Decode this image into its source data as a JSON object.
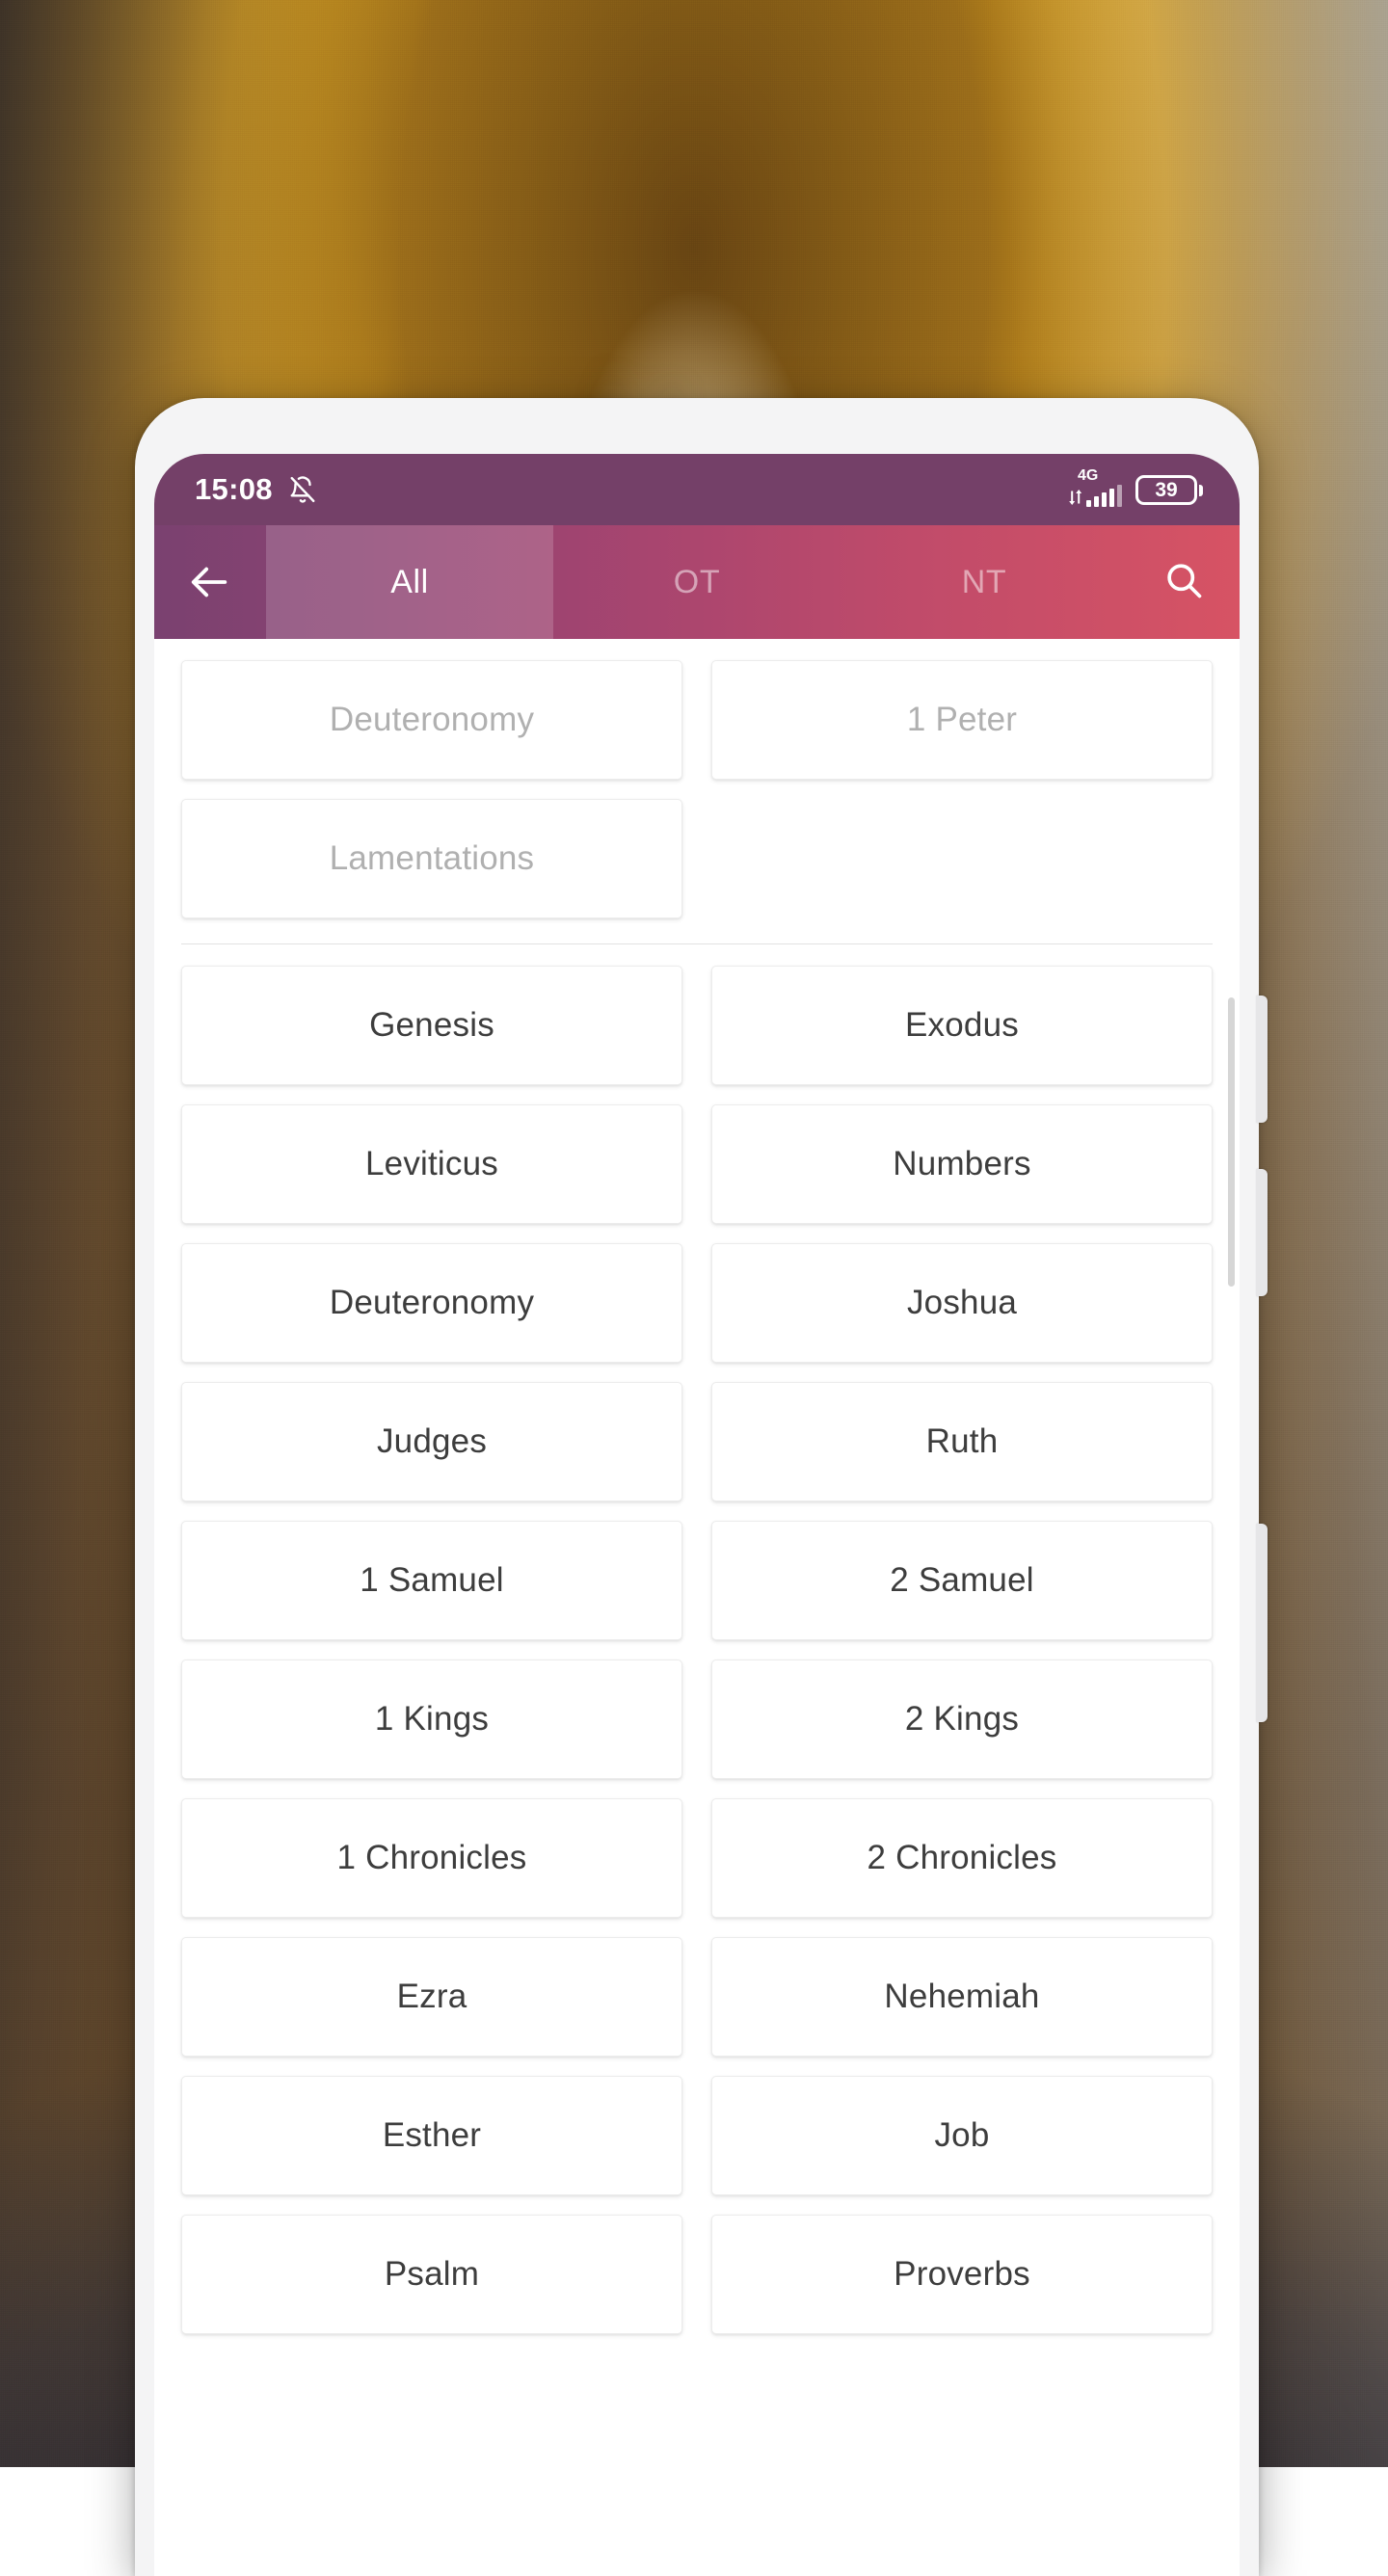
{
  "background": {
    "description": "blurred golden arched tunnel photo",
    "gold": "#f5bd1c",
    "brown": "#8a6434",
    "navy": "#1d2640"
  },
  "phone": {
    "bezel_color": "#f4f4f5",
    "buttons": [
      {
        "name": "volume-up"
      },
      {
        "name": "volume-down"
      },
      {
        "name": "power"
      }
    ]
  },
  "statusbar": {
    "background": "#744068",
    "clock": "15:08",
    "silent_icon": "bell-slash-icon",
    "network_label": "4G",
    "data_icon": "data-transfer-icon",
    "signal_icon": "signal-bars-icon",
    "battery_level": "39",
    "battery_icon": "battery-icon"
  },
  "appbar": {
    "gradient_start": "#7a4170",
    "gradient_end": "#d75364",
    "back_icon": "arrow-left-icon",
    "search_icon": "search-icon",
    "tabs": [
      {
        "label": "All",
        "active": true
      },
      {
        "label": "OT",
        "active": false
      },
      {
        "label": "NT",
        "active": false
      }
    ]
  },
  "content": {
    "recent_books": [
      "Deuteronomy",
      "1 Peter",
      "Lamentations"
    ],
    "books": [
      "Genesis",
      "Exodus",
      "Leviticus",
      "Numbers",
      "Deuteronomy",
      "Joshua",
      "Judges",
      "Ruth",
      "1 Samuel",
      "2 Samuel",
      "1 Kings",
      "2 Kings",
      "1 Chronicles",
      "2 Chronicles",
      "Ezra",
      "Nehemiah",
      "Esther",
      "Job",
      "Psalm",
      "Proverbs"
    ],
    "scrollbar": "vertical-scrollbar"
  }
}
